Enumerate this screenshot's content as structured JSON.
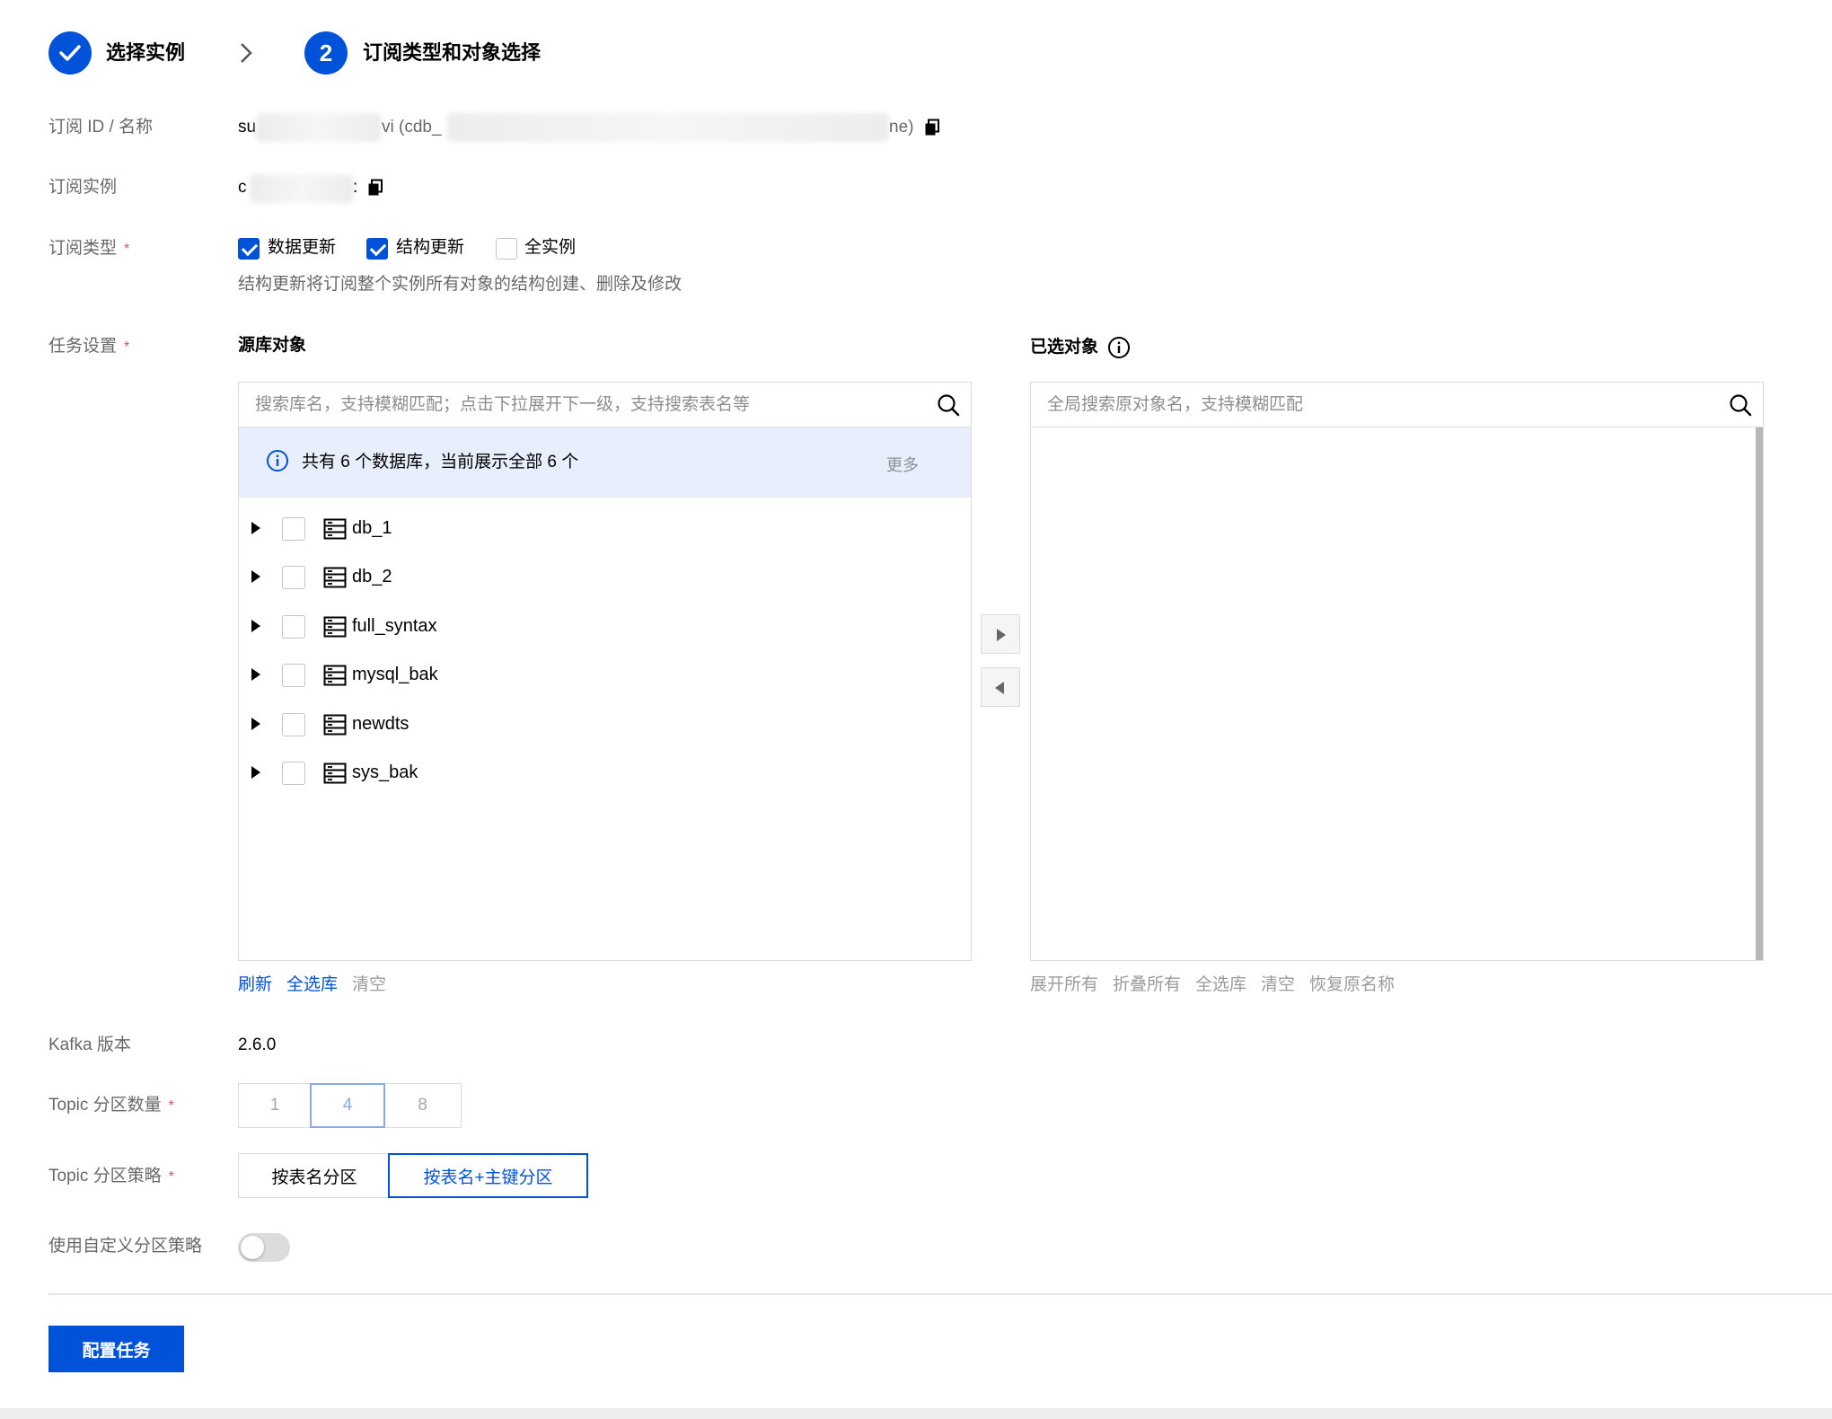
{
  "stepper": {
    "step1_label": "选择实例",
    "step2_number": "2",
    "step2_label": "订阅类型和对象选择"
  },
  "fields": {
    "subscription_id_label": "订阅 ID / 名称",
    "subscription_id_prefix": "su",
    "subscription_id_middle": "vi (cdb_",
    "subscription_id_suffix": "ne)",
    "instance_label": "订阅实例",
    "instance_prefix": "c",
    "instance_suffix": ":",
    "type_label": "订阅类型",
    "type_required": "*",
    "task_label": "任务设置",
    "task_required": "*",
    "kafka_label": "Kafka 版本",
    "kafka_value": "2.6.0",
    "partition_count_label": "Topic 分区数量",
    "partition_count_required": "*",
    "partition_strategy_label": "Topic 分区策略",
    "partition_strategy_required": "*",
    "custom_strategy_label": "使用自定义分区策略"
  },
  "subscription_types": [
    {
      "label": "数据更新",
      "checked": true
    },
    {
      "label": "结构更新",
      "checked": true
    },
    {
      "label": "全实例",
      "checked": false
    }
  ],
  "type_hint": "结构更新将订阅整个实例所有对象的结构创建、删除及修改",
  "source_panel": {
    "title": "源库对象",
    "search_placeholder": "搜索库名，支持模糊匹配；点击下拉展开下一级，支持搜索表名等",
    "info_text": "共有 6 个数据库，当前展示全部 6 个",
    "more_label": "更多",
    "databases": [
      "db_1",
      "db_2",
      "full_syntax",
      "mysql_bak",
      "newdts",
      "sys_bak"
    ],
    "actions": {
      "refresh": "刷新",
      "select_all": "全选库",
      "clear": "清空"
    }
  },
  "selected_panel": {
    "title": "已选对象",
    "search_placeholder": "全局搜索原对象名，支持模糊匹配",
    "actions": {
      "expand_all": "展开所有",
      "collapse_all": "折叠所有",
      "select_all": "全选库",
      "clear": "清空",
      "restore_names": "恢复原名称"
    }
  },
  "partition_counts": {
    "options": [
      "1",
      "4",
      "8"
    ],
    "selected": "4"
  },
  "partition_strategies": {
    "options": [
      "按表名分区",
      "按表名+主键分区"
    ],
    "selected": "按表名+主键分区"
  },
  "custom_strategy_enabled": false,
  "submit_label": "配置任务",
  "colors": {
    "primary": "#0052d9",
    "info_bg": "#e8eefc",
    "required": "#e34d59"
  }
}
